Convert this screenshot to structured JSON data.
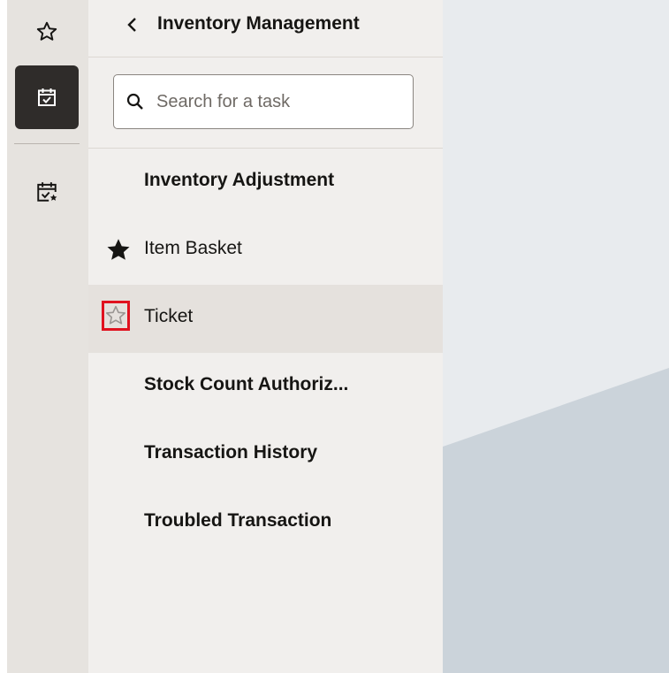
{
  "rail": {
    "items": [
      {
        "icon": "star-outline-icon",
        "active": false
      },
      {
        "icon": "calendar-check-icon",
        "active": true
      },
      {
        "icon": "calendar-check-star-icon",
        "active": false
      }
    ]
  },
  "panel": {
    "title": "Inventory Management",
    "search": {
      "placeholder": "Search for a task",
      "value": ""
    },
    "tasks": [
      {
        "label": "Inventory Adjustment",
        "favorite": "none"
      },
      {
        "label": "Item Basket",
        "favorite": "filled"
      },
      {
        "label": "Ticket",
        "favorite": "outline-highlighted"
      },
      {
        "label": "Stock Count Authoriz...",
        "favorite": "none"
      },
      {
        "label": "Transaction History",
        "favorite": "none"
      },
      {
        "label": "Troubled Transaction",
        "favorite": "none"
      }
    ]
  },
  "colors": {
    "rail_bg": "#e6e3df",
    "rail_active": "#2f2c2a",
    "panel_bg": "#f1efed",
    "hover_row": "#e5e1dd",
    "highlight_box": "#e0121f",
    "content_light": "#e8ebee",
    "content_dark": "#cbd3da"
  }
}
